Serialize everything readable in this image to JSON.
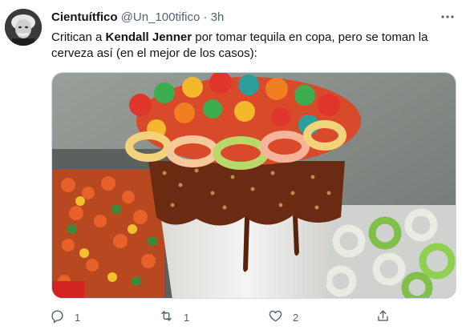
{
  "tweet": {
    "display_name": "Cientuítfico",
    "handle": "@Un_100tifico",
    "separator": "·",
    "time": "3h",
    "text_before": "Critican a ",
    "text_bold": "Kendall Jenner",
    "text_after": " por tomar tequila en copa, pero se toman la cerveza así (en el mejor de los casos):"
  },
  "actions": {
    "reply_count": "1",
    "retweet_count": "1",
    "like_count": "2"
  },
  "colors": {
    "text": "#0f1419",
    "secondary": "#536471",
    "border": "#cfd9de"
  },
  "icons": [
    "more-icon",
    "reply-icon",
    "retweet-icon",
    "like-icon",
    "share-icon"
  ]
}
